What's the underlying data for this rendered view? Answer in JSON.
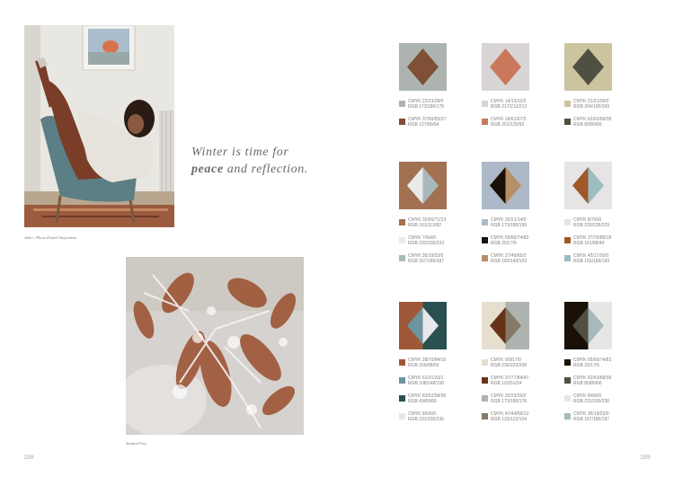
{
  "left_page": {
    "caption_portrait": "Aalto / Photo Eemeli Sarjaniemi",
    "quote_line1": "Winter is time for",
    "quote_bold": "peace",
    "quote_rest": "and reflection.",
    "caption_leaves": "Sandra Frey",
    "page_number": "188"
  },
  "right_page": {
    "page_number": "189",
    "palettes": [
      {
        "entries": [
          {
            "cmyk": "CMYK 23/23/28/0",
            "rgb": "RGB 173/180/176",
            "color": "#adb4b0"
          },
          {
            "cmyk": "CMYK 37/60/83/37",
            "rgb": "RGB 127/80/54",
            "color": "#7f5036"
          }
        ]
      },
      {
        "entries": [
          {
            "cmyk": "CMYK 14/13/12/0",
            "rgb": "RGB 217/213/213",
            "color": "#d9d5d5"
          },
          {
            "cmyk": "CMYK 18/61/67/3",
            "rgb": "RGB 201/120/92",
            "color": "#c9785c"
          }
        ]
      },
      {
        "entries": [
          {
            "cmyk": "CMYK 21/21/39/0",
            "rgb": "RGB 204/195/159",
            "color": "#ccc39f"
          },
          {
            "cmyk": "CMYK 62/63/68/38",
            "rgb": "RGB 80/80/66",
            "color": "#505042"
          }
        ]
      },
      {
        "entries": [
          {
            "cmyk": "CMYK 32/65/71/13",
            "rgb": "RGB 161/113/82",
            "color": "#a17152"
          },
          {
            "cmyk": "CMYK 7/6/4/0",
            "rgb": "RGB 233/235/233",
            "color": "#e9ebe9"
          },
          {
            "cmyk": "CMYK 35/19/23/0",
            "rgb": "RGB 167/185/187",
            "color": "#a7b9bb"
          }
        ]
      },
      {
        "entries": [
          {
            "cmyk": "CMYK 32/21/14/0",
            "rgb": "RGB 173/185/199",
            "color": "#adb9c7"
          },
          {
            "cmyk": "CMYK 65/66/74/83",
            "rgb": "RGB 25/17/5",
            "color": "#191105"
          },
          {
            "cmyk": "CMYK 27/49/65/3",
            "rgb": "RGB 183/143/103",
            "color": "#b78f67"
          }
        ]
      },
      {
        "entries": [
          {
            "cmyk": "CMYK 8/7/6/0",
            "rgb": "RGB 230/228/229",
            "color": "#e6e4e5"
          },
          {
            "cmyk": "CMYK 27/70/88/18",
            "rgb": "RGB 161/88/40",
            "color": "#a15828"
          },
          {
            "cmyk": "CMYK 45/17/20/0",
            "rgb": "RGB 155/189/193",
            "color": "#9bbdc1"
          }
        ]
      },
      {
        "entries": [
          {
            "cmyk": "CMYK 28/70/84/16",
            "rgb": "RGB 159/88/55",
            "color": "#9f5837"
          },
          {
            "cmyk": "CMYK 61/31/33/1",
            "rgb": "RGB 108/148/158",
            "color": "#6c949e"
          },
          {
            "cmyk": "CMYK 83/52/58/36",
            "rgb": "RGB 43/80/80",
            "color": "#2b5050"
          },
          {
            "cmyk": "CMYK 8/6/6/0",
            "rgb": "RGB 231/230/236",
            "color": "#e7e6ec"
          }
        ]
      },
      {
        "entries": [
          {
            "cmyk": "CMYK 9/9/17/0",
            "rgb": "RGB 230/223/208",
            "color": "#e6dfd0"
          },
          {
            "cmyk": "CMYK 37/77/84/47",
            "rgb": "RGB 103/51/24",
            "color": "#673318"
          },
          {
            "cmyk": "CMYK 33/23/26/0",
            "rgb": "RGB 173/180/176",
            "color": "#adb4b0"
          },
          {
            "cmyk": "CMYK 47/44/59/13",
            "rgb": "RGB 133/122/104",
            "color": "#857a68"
          }
        ]
      },
      {
        "entries": [
          {
            "cmyk": "CMYK 65/66/74/83",
            "rgb": "RGB 25/17/5",
            "color": "#191105"
          },
          {
            "cmyk": "CMYK 62/63/68/38",
            "rgb": "RGB 80/80/66",
            "color": "#505042"
          },
          {
            "cmyk": "CMYK 8/6/6/0",
            "rgb": "RGB 231/230/230",
            "color": "#e7e6e6"
          },
          {
            "cmyk": "CMYK 35/19/23/0",
            "rgb": "RGB 167/185/187",
            "color": "#a7b9bb"
          }
        ]
      }
    ]
  }
}
